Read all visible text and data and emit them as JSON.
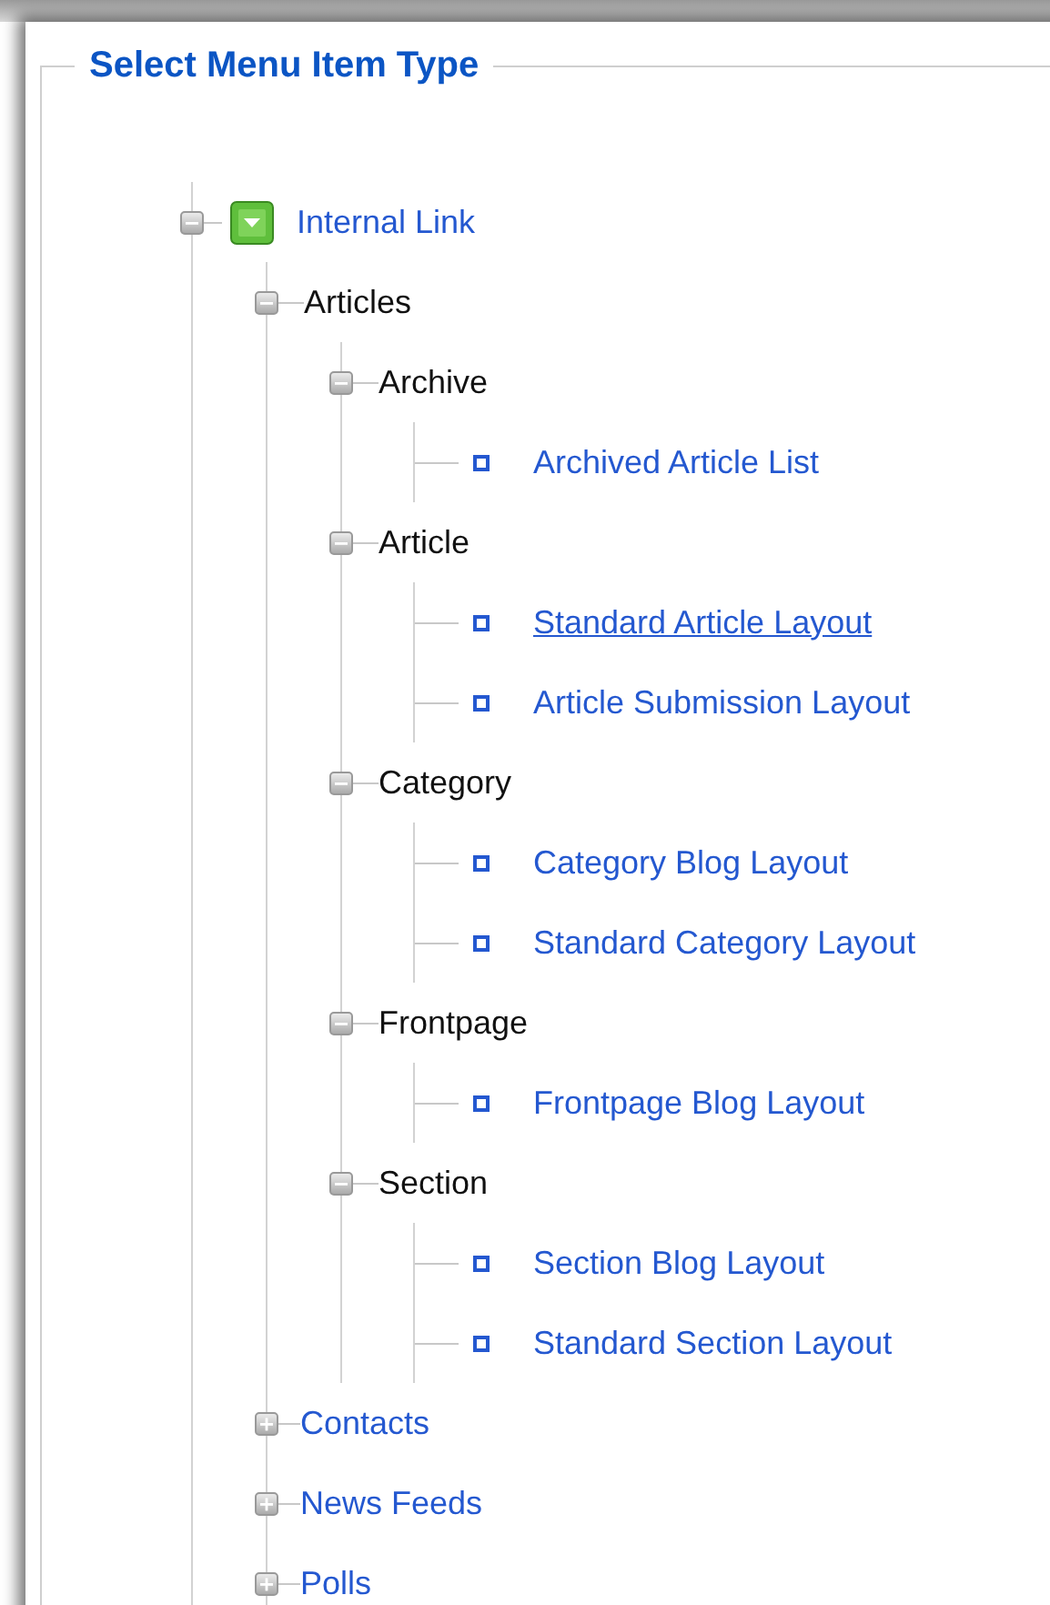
{
  "legend": "Select Menu Item Type",
  "tree": [
    {
      "label": "Internal Link",
      "kind": "root",
      "expanded": true,
      "children": [
        {
          "label": "Articles",
          "kind": "group",
          "expanded": true,
          "children": [
            {
              "label": "Archive",
              "kind": "group",
              "expanded": true,
              "children": [
                {
                  "label": "Archived Article List",
                  "kind": "leaf",
                  "hovered": false
                }
              ]
            },
            {
              "label": "Article",
              "kind": "group",
              "expanded": true,
              "children": [
                {
                  "label": "Standard Article Layout",
                  "kind": "leaf",
                  "hovered": true
                },
                {
                  "label": "Article Submission Layout",
                  "kind": "leaf",
                  "hovered": false
                }
              ]
            },
            {
              "label": "Category",
              "kind": "group",
              "expanded": true,
              "children": [
                {
                  "label": "Category Blog Layout",
                  "kind": "leaf",
                  "hovered": false
                },
                {
                  "label": "Standard Category Layout",
                  "kind": "leaf",
                  "hovered": false
                }
              ]
            },
            {
              "label": "Frontpage",
              "kind": "group",
              "expanded": true,
              "children": [
                {
                  "label": "Frontpage Blog Layout",
                  "kind": "leaf",
                  "hovered": false
                }
              ]
            },
            {
              "label": "Section",
              "kind": "group",
              "expanded": true,
              "children": [
                {
                  "label": "Section Blog Layout",
                  "kind": "leaf",
                  "hovered": false
                },
                {
                  "label": "Standard Section Layout",
                  "kind": "leaf",
                  "hovered": false
                }
              ]
            }
          ]
        },
        {
          "label": "Contacts",
          "kind": "group",
          "expanded": false
        },
        {
          "label": "News Feeds",
          "kind": "group",
          "expanded": false
        },
        {
          "label": "Polls",
          "kind": "group",
          "expanded": false
        }
      ]
    }
  ]
}
